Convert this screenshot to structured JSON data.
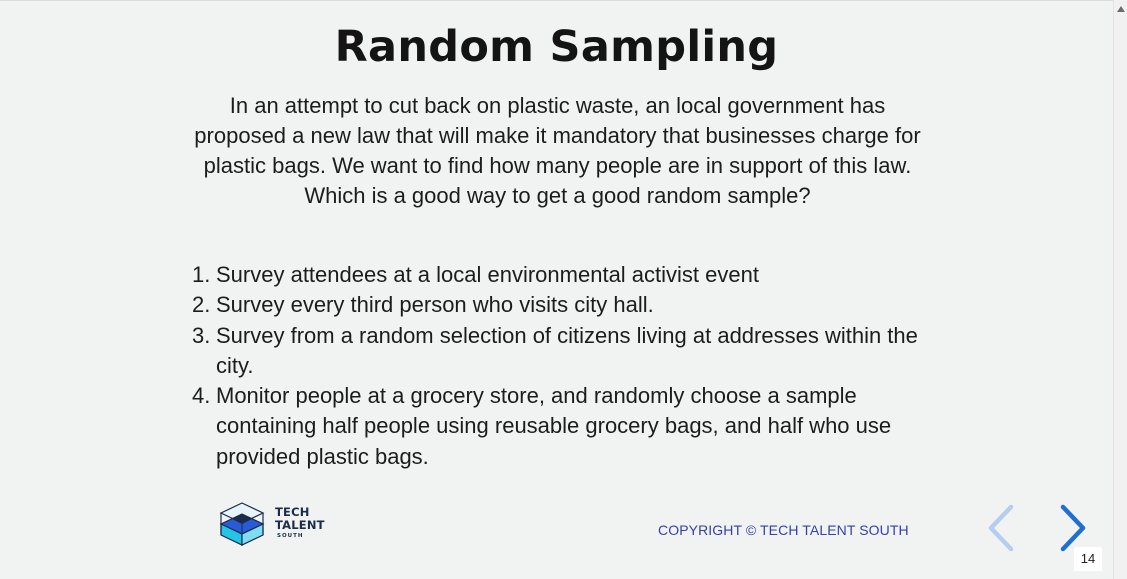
{
  "slide": {
    "title": "Random Sampling",
    "intro": "In an attempt to cut back on plastic waste, an local government has proposed a new law that will make it mandatory that businesses charge for plastic bags. We want to find how many people are in support of this law. Which is a good way to get a good random sample?",
    "options": [
      {
        "num": "1.",
        "text": "Survey attendees at a local environmental activist event"
      },
      {
        "num": "2.",
        "text": "Survey every third person who visits city hall."
      },
      {
        "num": "3.",
        "text": "Survey from a random selection of citizens living at addresses within the city."
      },
      {
        "num": "4.",
        "text": "Monitor people at a grocery store, and randomly choose a sample containing half people using reusable grocery bags, and half who use provided plastic bags."
      }
    ]
  },
  "footer": {
    "logo": {
      "line1": "TECH",
      "line2": "TALENT",
      "line3": "SOUTH"
    },
    "copyright": "COPYRIGHT © TECH TALENT SOUTH",
    "page_number": "14",
    "prev_icon": "chevron-left-icon",
    "next_icon": "chevron-right-icon"
  },
  "colors": {
    "background": "#f1f3f2",
    "title": "#141414",
    "copyright": "#3341a8",
    "nav_prev": "#b5cdee",
    "nav_next": "#1f6fd0",
    "logo_blue": "#2a5bd7",
    "logo_cyan": "#22c4e8"
  },
  "scrollbar": {
    "up_icon": "scroll-up-arrow-icon"
  }
}
